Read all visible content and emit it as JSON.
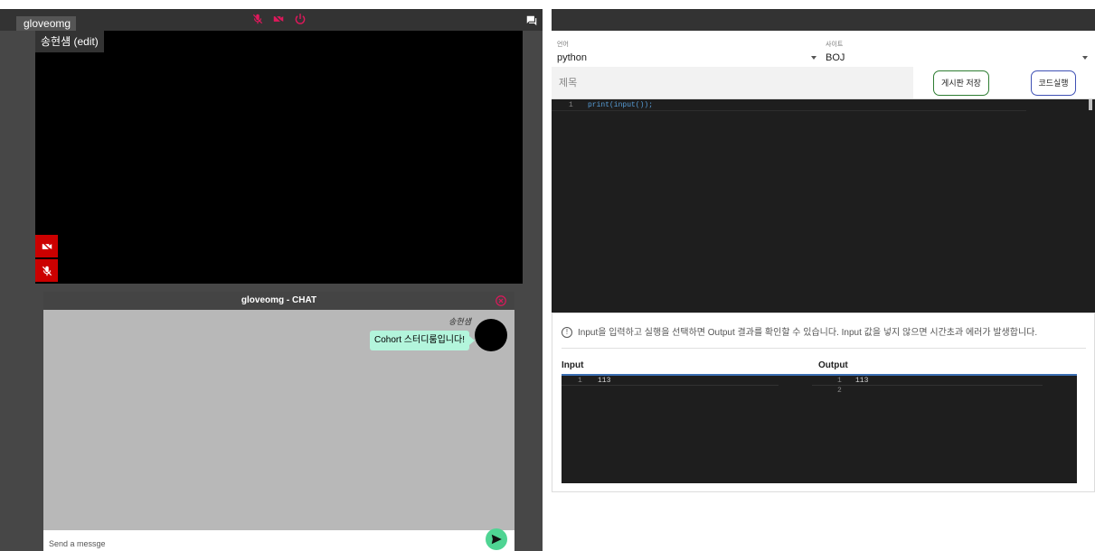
{
  "session": {
    "name": "gloveomg"
  },
  "video": {
    "nickname": "송현섐 (edit)"
  },
  "chat": {
    "title": "gloveomg - CHAT",
    "messages": [
      {
        "user": "송현섐",
        "text": "Cohort 스터디룸입니다!"
      }
    ],
    "input_placeholder": "Send a messge"
  },
  "editor": {
    "language_label": "언어",
    "language_value": "python",
    "site_label": "사이트",
    "site_value": "BOJ",
    "title_placeholder": "제목",
    "save_button": "게시판 저장",
    "run_button": "코드실행",
    "code_lines": [
      {
        "num": "1",
        "text": "print(input());"
      }
    ]
  },
  "io": {
    "info_text": "Input을 입력하고 실행을 선택하면 Output 결과를 확인할 수 있습니다. Input 값을 넣지 않으면 시간초과 에러가 발생합니다.",
    "input_label": "Input",
    "output_label": "Output",
    "input_lines": [
      {
        "num": "1",
        "text": "113"
      }
    ],
    "output_lines": [
      {
        "num": "1",
        "text": "113"
      },
      {
        "num": "2",
        "text": ""
      }
    ]
  },
  "colors": {
    "control_icons": "#e0185c",
    "video_status_bg": "#cc0000",
    "chat_bubble": "#b3f5dc",
    "send_button": "#4fd493",
    "save_button_border": "#2e7d32",
    "run_button_border": "#3f51b5",
    "code_keyword": "#569cd6"
  },
  "icons": {
    "mic_off": "mic-off-icon",
    "video_off": "video-off-icon",
    "power": "power-icon",
    "chat_toggle": "chat-icon",
    "chat_close": "close-icon",
    "send": "send-icon",
    "info": "info-icon"
  }
}
